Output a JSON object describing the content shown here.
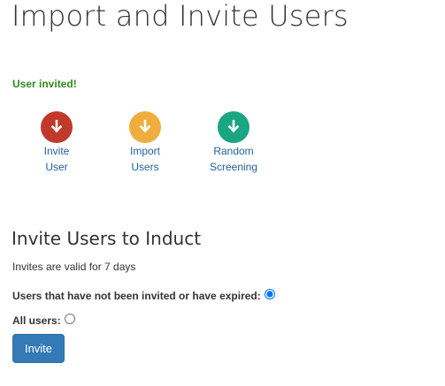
{
  "header": {
    "title": "Import and Invite Users"
  },
  "alert": {
    "message": "User invited!",
    "color": "#2e8b1e"
  },
  "actions": [
    {
      "line1": "Invite",
      "line2": "User",
      "color": "#c0392b",
      "icon": "download-arrow-icon"
    },
    {
      "line1": "Import",
      "line2": "Users",
      "color": "#f0ad3e",
      "icon": "download-arrow-icon"
    },
    {
      "line1": "Random",
      "line2": "Screening",
      "color": "#1aa583",
      "icon": "download-arrow-icon"
    }
  ],
  "link_color": "#1f5f9e",
  "invite_section": {
    "title": "Invite Users to Induct",
    "validity_note": "Invites are valid for 7 days",
    "options": [
      {
        "label": "Users that have not been invited or have expired:",
        "selected": true
      },
      {
        "label": "All users:",
        "selected": false
      }
    ],
    "submit_label": "Invite"
  }
}
